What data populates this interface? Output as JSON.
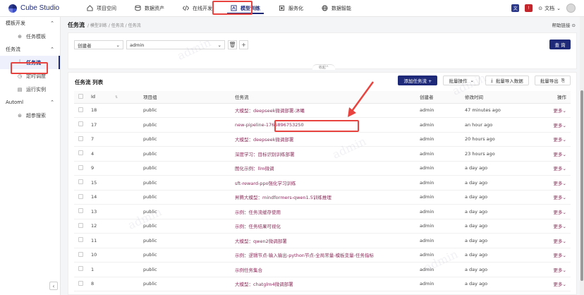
{
  "app": {
    "name": "Cube Studio",
    "help_label": "文档"
  },
  "nav": [
    {
      "label": "项目空间",
      "icon": "home-icon"
    },
    {
      "label": "数据资产",
      "icon": "database-icon"
    },
    {
      "label": "在线开发",
      "icon": "code-icon"
    },
    {
      "label": "模型训练",
      "icon": "training-icon",
      "active": true
    },
    {
      "label": "服务化",
      "icon": "cube-icon"
    },
    {
      "label": "数据智能",
      "icon": "globe-icon"
    }
  ],
  "sidebar": {
    "groups": [
      {
        "label": "模板开发",
        "items": [
          {
            "label": "任务模板"
          }
        ]
      },
      {
        "label": "任务流",
        "items": [
          {
            "label": "任务流",
            "active": true
          },
          {
            "label": "定时调度"
          },
          {
            "label": "运行实例"
          }
        ]
      },
      {
        "label": "Automl",
        "items": [
          {
            "label": "超参搜索"
          }
        ]
      }
    ]
  },
  "page": {
    "title": "任务流",
    "breadcrumb": "/ 模型训练 / 任务流 / 任务流",
    "help": "帮助链接"
  },
  "filter": {
    "field": "创建者",
    "value": "admin",
    "search_label": "查 询",
    "collapse_label": "收起^"
  },
  "table": {
    "title": "任务流 列表",
    "add_label": "添加任务流 +",
    "batch_label": "批量操作",
    "import_label": "批量导入数据",
    "export_label": "批量导出",
    "columns": [
      "Id",
      "项目组",
      "任务流",
      "创建者",
      "修改时间",
      "操作"
    ],
    "more_label": "更多",
    "rows": [
      {
        "id": "18",
        "group": "public",
        "pipeline": "大模型：deepseek微调部署-沐曦",
        "creator": "admin",
        "modified": "47 minutes ago"
      },
      {
        "id": "17",
        "group": "public",
        "pipeline": "new-pipeline-1765896753250",
        "creator": "admin",
        "modified": "an hour ago"
      },
      {
        "id": "7",
        "group": "public",
        "pipeline": "大模型：deepseek微调部署",
        "creator": "admin",
        "modified": "20 hours ago"
      },
      {
        "id": "4",
        "group": "public",
        "pipeline": "深度学习：目标识别训练部署",
        "creator": "admin",
        "modified": "23 hours ago"
      },
      {
        "id": "9",
        "group": "public",
        "pipeline": "图化示例：llm微调",
        "creator": "admin",
        "modified": "a day ago"
      },
      {
        "id": "15",
        "group": "public",
        "pipeline": "sft-reward-ppo强化学习训练",
        "creator": "admin",
        "modified": "a day ago"
      },
      {
        "id": "14",
        "group": "public",
        "pipeline": "昇腾大模型：mindformers-qwen1.5训练推理",
        "creator": "admin",
        "modified": "a day ago"
      },
      {
        "id": "13",
        "group": "public",
        "pipeline": "示例：任务流缓存使用",
        "creator": "admin",
        "modified": "a day ago"
      },
      {
        "id": "12",
        "group": "public",
        "pipeline": "示例：任务结果可视化",
        "creator": "admin",
        "modified": "a day ago"
      },
      {
        "id": "11",
        "group": "public",
        "pipeline": "大模型：qwen2微调部署",
        "creator": "admin",
        "modified": "a day ago"
      },
      {
        "id": "10",
        "group": "public",
        "pipeline": "示例：逻辑节点-输入输出-python节点-全局常量-模板变量-任务指标",
        "creator": "admin",
        "modified": "a day ago"
      },
      {
        "id": "1",
        "group": "public",
        "pipeline": "示例任务集合",
        "creator": "admin",
        "modified": "a day ago"
      },
      {
        "id": "8",
        "group": "public",
        "pipeline": "大模型：chatglm4微调部署",
        "creator": "admin",
        "modified": "a day ago"
      }
    ]
  },
  "colors": {
    "brand": "#1e2a78",
    "link": "#8a2e5a",
    "highlight": "#e8433e"
  }
}
